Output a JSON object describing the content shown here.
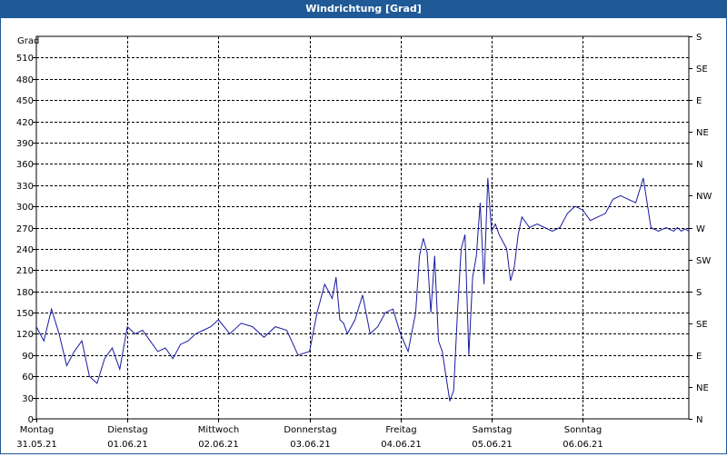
{
  "window": {
    "title": "Windrichtung [Grad]"
  },
  "colors": {
    "titlebar": "#1f5a96",
    "series": "#1a1aa0",
    "grid": "#000000"
  },
  "chart_data": {
    "type": "line",
    "title": "Windrichtung [Grad]",
    "ylabel": "Grad",
    "ylim": [
      0,
      540
    ],
    "yticks": [
      0,
      30,
      60,
      90,
      120,
      150,
      180,
      210,
      240,
      270,
      300,
      330,
      360,
      390,
      420,
      450,
      480,
      510
    ],
    "right_axis_labels": [
      "N",
      "NE",
      "E",
      "SE",
      "S",
      "SW",
      "W",
      "NW",
      "N",
      "NE",
      "E",
      "SE",
      "S"
    ],
    "xlim": [
      "2021-05-31T00:00",
      "2021-06-07T04:00"
    ],
    "x_ticks": [
      {
        "day": "Montag",
        "date": "31.05.21",
        "x": "2021-05-31T00:00"
      },
      {
        "day": "Dienstag",
        "date": "01.06.21",
        "x": "2021-06-01T00:00"
      },
      {
        "day": "Mittwoch",
        "date": "02.06.21",
        "x": "2021-06-02T00:00"
      },
      {
        "day": "Donnerstag",
        "date": "03.06.21",
        "x": "2021-06-03T00:00"
      },
      {
        "day": "Freitag",
        "date": "04.06.21",
        "x": "2021-06-04T00:00"
      },
      {
        "day": "Samstag",
        "date": "05.06.21",
        "x": "2021-06-05T00:00"
      },
      {
        "day": "Sonntag",
        "date": "06.06.21",
        "x": "2021-06-06T00:00"
      }
    ],
    "grid": true,
    "series": [
      {
        "x": [
          "2021-05-31T00:00",
          "2021-05-31T02:00",
          "2021-05-31T04:00",
          "2021-05-31T06:00",
          "2021-05-31T08:00",
          "2021-05-31T10:00",
          "2021-05-31T12:00",
          "2021-05-31T14:00",
          "2021-05-31T16:00",
          "2021-05-31T18:00",
          "2021-05-31T20:00",
          "2021-05-31T22:00",
          "2021-06-01T00:00",
          "2021-06-01T02:00",
          "2021-06-01T04:00",
          "2021-06-01T06:00",
          "2021-06-01T08:00",
          "2021-06-01T10:00",
          "2021-06-01T12:00",
          "2021-06-01T14:00",
          "2021-06-01T16:00",
          "2021-06-01T18:00",
          "2021-06-01T20:00",
          "2021-06-01T22:00",
          "2021-06-02T00:00",
          "2021-06-02T03:00",
          "2021-06-02T06:00",
          "2021-06-02T09:00",
          "2021-06-02T12:00",
          "2021-06-02T15:00",
          "2021-06-02T18:00",
          "2021-06-02T21:00",
          "2021-06-03T00:00",
          "2021-06-03T02:00",
          "2021-06-03T04:00",
          "2021-06-03T06:00",
          "2021-06-03T07:00",
          "2021-06-03T08:00",
          "2021-06-03T09:00",
          "2021-06-03T10:00",
          "2021-06-03T12:00",
          "2021-06-03T14:00",
          "2021-06-03T16:00",
          "2021-06-03T18:00",
          "2021-06-03T20:00",
          "2021-06-03T22:00",
          "2021-06-04T00:00",
          "2021-06-04T02:00",
          "2021-06-04T04:00",
          "2021-06-04T05:00",
          "2021-06-04T06:00",
          "2021-06-04T07:00",
          "2021-06-04T08:00",
          "2021-06-04T09:00",
          "2021-06-04T10:00",
          "2021-06-04T11:00",
          "2021-06-04T12:00",
          "2021-06-04T13:00",
          "2021-06-04T14:00",
          "2021-06-04T15:00",
          "2021-06-04T16:00",
          "2021-06-04T17:00",
          "2021-06-04T18:00",
          "2021-06-04T19:00",
          "2021-06-04T20:00",
          "2021-06-04T21:00",
          "2021-06-04T22:00",
          "2021-06-04T23:00",
          "2021-06-05T00:00",
          "2021-06-05T01:00",
          "2021-06-05T02:00",
          "2021-06-05T03:00",
          "2021-06-05T04:00",
          "2021-06-05T05:00",
          "2021-06-05T06:00",
          "2021-06-05T07:00",
          "2021-06-05T08:00",
          "2021-06-05T10:00",
          "2021-06-05T12:00",
          "2021-06-05T14:00",
          "2021-06-05T16:00",
          "2021-06-05T18:00",
          "2021-06-05T20:00",
          "2021-06-05T22:00",
          "2021-06-06T00:00",
          "2021-06-06T02:00",
          "2021-06-06T04:00",
          "2021-06-06T06:00",
          "2021-06-06T08:00",
          "2021-06-06T10:00",
          "2021-06-06T12:00",
          "2021-06-06T14:00",
          "2021-06-06T16:00",
          "2021-06-06T18:00",
          "2021-06-06T20:00",
          "2021-06-06T22:00",
          "2021-06-07T00:00",
          "2021-06-07T01:00",
          "2021-06-07T02:00",
          "2021-06-07T03:00",
          "2021-06-07T04:00"
        ],
        "values": [
          130,
          110,
          155,
          120,
          75,
          95,
          110,
          60,
          50,
          85,
          100,
          70,
          130,
          120,
          125,
          110,
          95,
          100,
          85,
          105,
          110,
          120,
          125,
          130,
          140,
          120,
          135,
          130,
          115,
          130,
          125,
          90,
          95,
          150,
          190,
          170,
          200,
          140,
          135,
          120,
          140,
          175,
          120,
          130,
          150,
          155,
          120,
          95,
          150,
          230,
          255,
          235,
          150,
          230,
          110,
          95,
          60,
          25,
          40,
          150,
          240,
          260,
          90,
          200,
          230,
          305,
          190,
          340,
          265,
          275,
          260,
          250,
          240,
          195,
          215,
          260,
          285,
          270,
          275,
          270,
          265,
          270,
          290,
          300,
          295,
          280,
          285,
          290,
          310,
          315,
          310,
          305,
          340,
          270,
          265,
          270,
          265,
          270,
          265,
          268,
          265
        ]
      }
    ]
  }
}
